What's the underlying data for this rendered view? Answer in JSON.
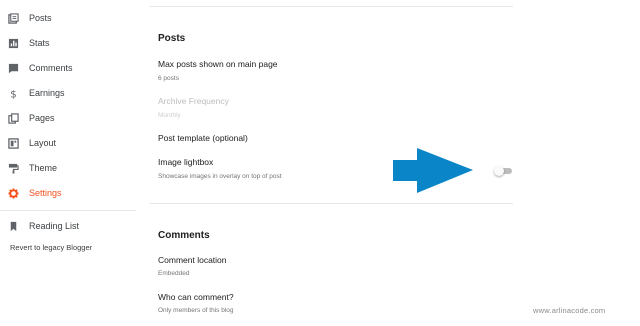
{
  "sidebar": {
    "items": [
      {
        "label": "Posts",
        "icon": "posts-icon",
        "active": false
      },
      {
        "label": "Stats",
        "icon": "stats-icon",
        "active": false
      },
      {
        "label": "Comments",
        "icon": "comments-icon",
        "active": false
      },
      {
        "label": "Earnings",
        "icon": "dollar-icon",
        "active": false
      },
      {
        "label": "Pages",
        "icon": "pages-icon",
        "active": false
      },
      {
        "label": "Layout",
        "icon": "layout-icon",
        "active": false
      },
      {
        "label": "Theme",
        "icon": "paint-roller-icon",
        "active": false
      },
      {
        "label": "Settings",
        "icon": "gear-icon",
        "active": true
      }
    ],
    "reading_list": {
      "label": "Reading List",
      "icon": "bookmark-icon"
    },
    "legacy_link": "Revert to legacy Blogger",
    "active_color": "#f4511e"
  },
  "main": {
    "posts_section": {
      "title": "Posts",
      "max_posts": {
        "label": "Max posts shown on main page",
        "value": "6 posts"
      },
      "archive_frequency": {
        "label": "Archive Frequency",
        "value": "Monthly"
      },
      "post_template": {
        "label": "Post template (optional)"
      },
      "image_lightbox": {
        "label": "Image lightbox",
        "description": "Showcase images in overlay on top of post",
        "enabled": false
      }
    },
    "comments_section": {
      "title": "Comments",
      "comment_location": {
        "label": "Comment location",
        "value": "Embedded"
      },
      "who_can_comment": {
        "label": "Who can comment?",
        "value": "Only members of this blog"
      }
    }
  },
  "annotation": {
    "arrow_color": "#0a86c8"
  },
  "watermark": "www.arlinacode.com"
}
